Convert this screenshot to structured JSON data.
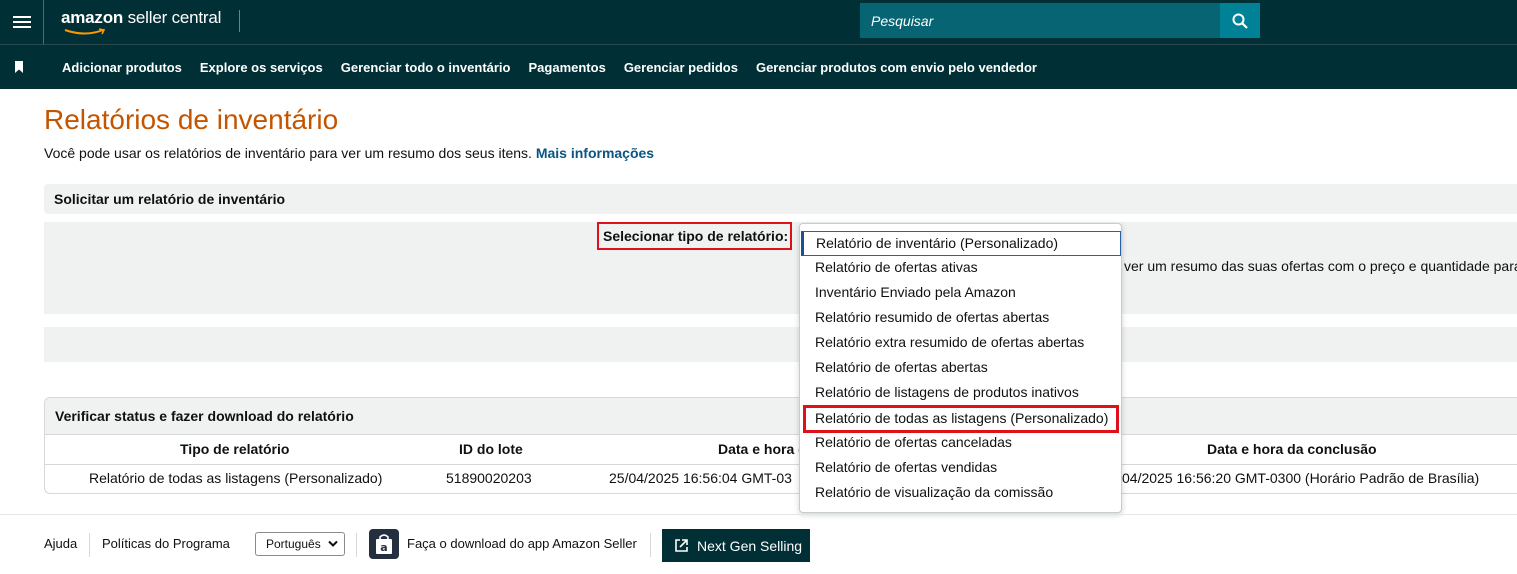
{
  "header": {
    "logo_amazon": "amazon",
    "logo_rest": " seller central",
    "search_placeholder": "Pesquisar"
  },
  "nav": {
    "items": [
      "Adicionar produtos",
      "Explore os serviços",
      "Gerenciar todo o inventário",
      "Pagamentos",
      "Gerenciar pedidos",
      "Gerenciar produtos com envio pelo vendedor"
    ]
  },
  "page": {
    "title": "Relatórios de inventário",
    "intro": "Você pode usar os relatórios de inventário para ver um resumo dos seus itens. ",
    "intro_link": "Mais informações"
  },
  "request_section": {
    "title": "Solicitar um relatório de inventário",
    "select_label": "Selecionar tipo de relatório:",
    "description_fragment": "ver um resumo das suas ofertas com o preço e quantidade para"
  },
  "dropdown": {
    "options": [
      "Relatório de inventário (Personalizado)",
      "Relatório de ofertas ativas",
      "Inventário Enviado pela Amazon",
      "Relatório resumido de ofertas abertas",
      "Relatório extra resumido de ofertas abertas",
      "Relatório de ofertas abertas",
      "Relatório de listagens de produtos inativos",
      "Relatório de todas as listagens (Personalizado)",
      "Relatório de ofertas canceladas",
      "Relatório de ofertas vendidas",
      "Relatório de visualização da comissão"
    ],
    "selected_index": 0,
    "highlighted_index": 7
  },
  "status_section": {
    "title": "Verificar status e fazer download do relatório",
    "columns": [
      "Tipo de relatório",
      "ID do lote",
      "Data e hora d",
      "Data e hora da conclusão"
    ],
    "row": {
      "type": "Relatório de todas as listagens (Personalizado)",
      "batch_id": "51890020203",
      "requested": "25/04/2025 16:56:04 GMT-03",
      "completed": "04/2025 16:56:20 GMT-0300 (Horário Padrão de Brasília)"
    }
  },
  "footer": {
    "help": "Ajuda",
    "policies": "Políticas do Programa",
    "language": "Português",
    "app_download": "Faça o download do app Amazon Seller",
    "next_gen": "Next Gen Selling"
  },
  "colors": {
    "header_bg": "#002f36",
    "search_bg": "#076473",
    "title_orange": "#c45500",
    "link_blue": "#0a5582",
    "highlight_red": "#e0101a"
  }
}
